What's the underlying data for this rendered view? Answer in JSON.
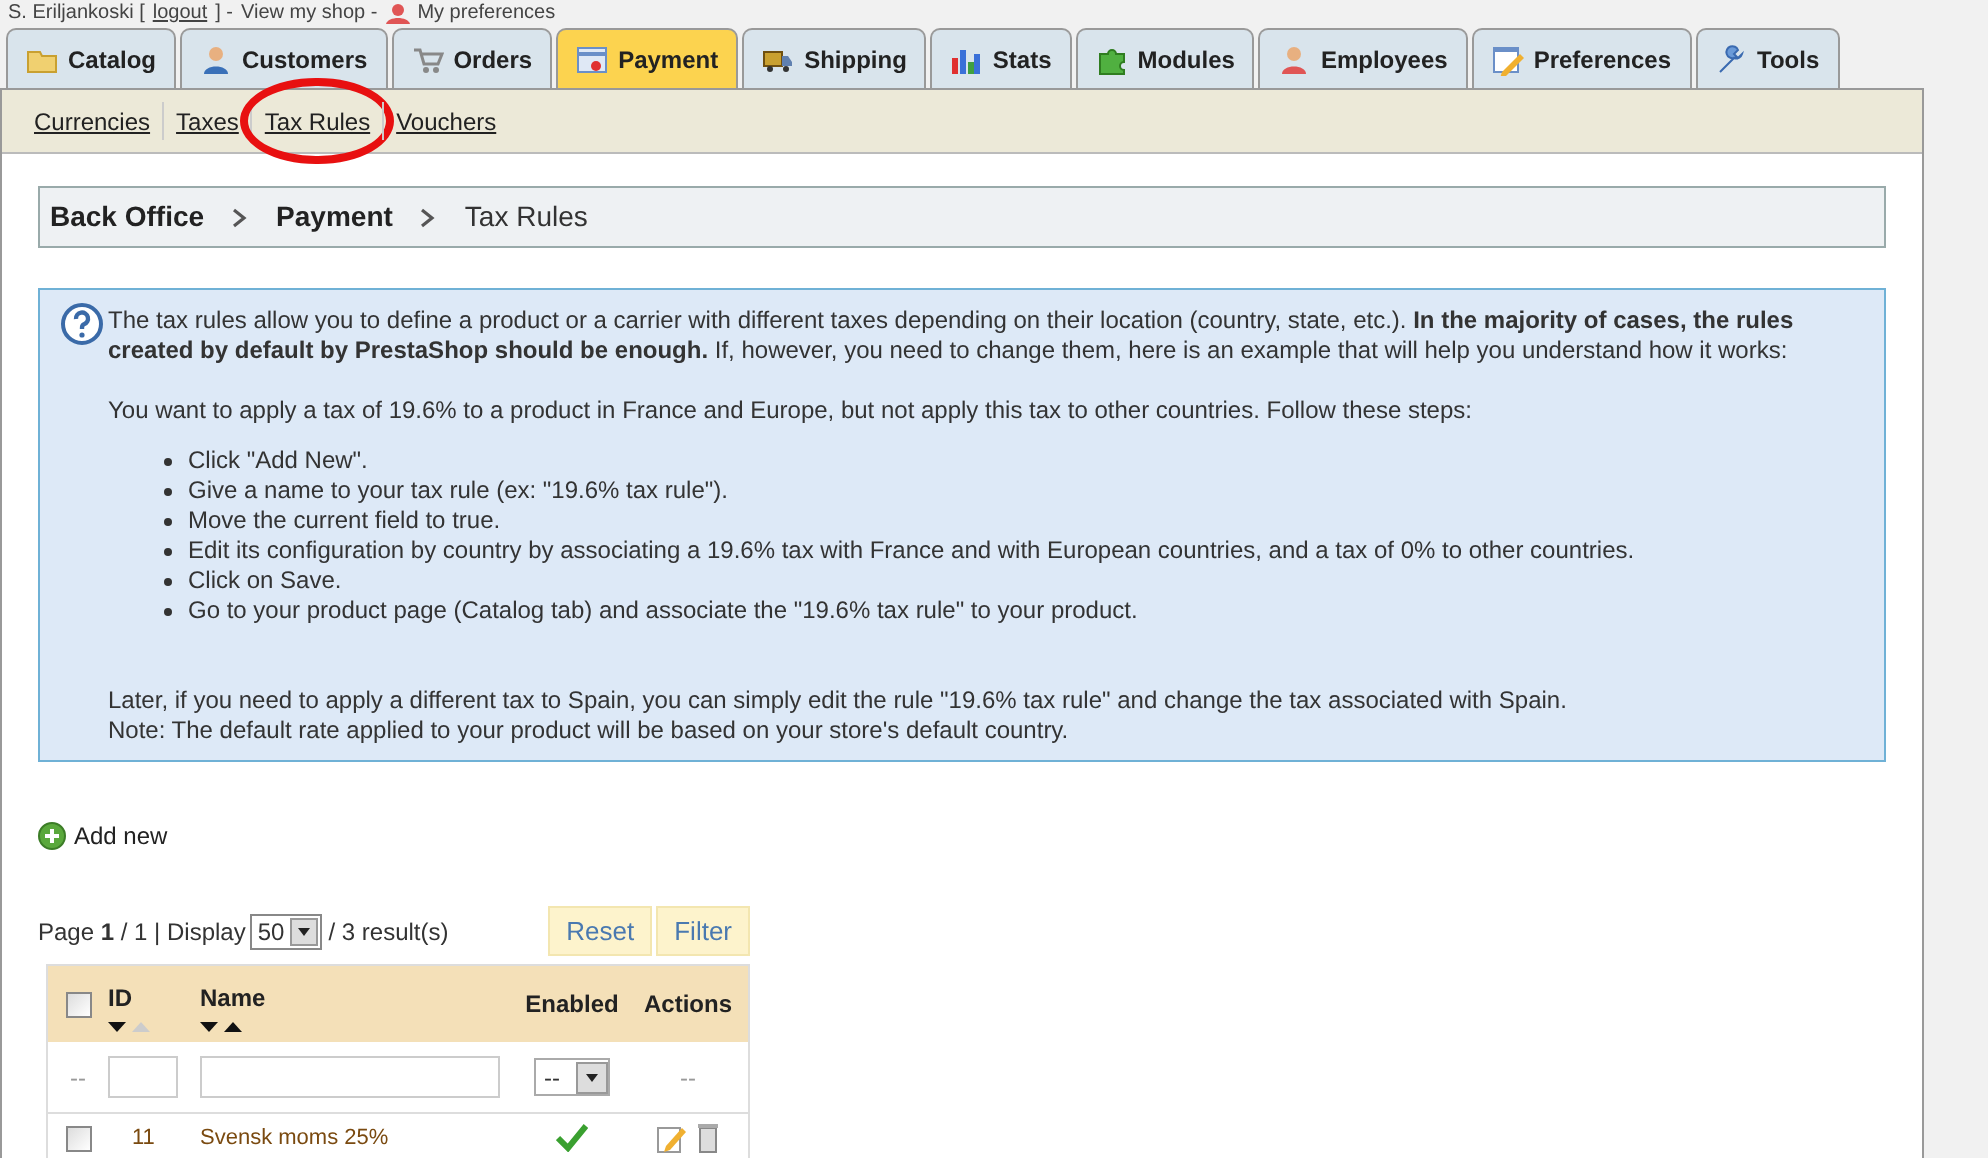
{
  "header": {
    "user": "S. Eriljankoski [",
    "logout": "logout",
    "after_logout": "] -",
    "view_shop": "View my shop -",
    "preferences": "My preferences"
  },
  "tabs": [
    {
      "label": "Catalog",
      "selected": false
    },
    {
      "label": "Customers",
      "selected": false
    },
    {
      "label": "Orders",
      "selected": false
    },
    {
      "label": "Payment",
      "selected": true
    },
    {
      "label": "Shipping",
      "selected": false
    },
    {
      "label": "Stats",
      "selected": false
    },
    {
      "label": "Modules",
      "selected": false
    },
    {
      "label": "Employees",
      "selected": false
    },
    {
      "label": "Preferences",
      "selected": false
    },
    {
      "label": "Tools",
      "selected": false
    }
  ],
  "subtabs": [
    {
      "label": "Currencies",
      "circled": false
    },
    {
      "label": "Taxes",
      "circled": false
    },
    {
      "label": "Tax Rules",
      "circled": true
    },
    {
      "label": "Vouchers",
      "circled": false
    }
  ],
  "breadcrumb": [
    "Back Office",
    "Payment",
    "Tax Rules"
  ],
  "info": {
    "intro": "The tax rules allow you to define a product or a carrier with different taxes depending on their location (country, state, etc.). **In the majority of cases, the rules created by default by PrestaShop should be enough.** If, however, you need to change them, here is an example that will help you understand how it works:",
    "example": "You want to apply a tax of 19.6% to a product in France and Europe, but not apply this tax to other countries. Follow these steps:",
    "steps": [
      "Click \"Add New\".",
      "Give a name to your tax rule (ex: \"19.6% tax rule\").",
      "Move the current field to true.",
      "Edit its configuration by country by associating a 19.6% tax with France and with European countries, and a tax of 0% to other countries.",
      "Click on Save.",
      "Go to your product page (Catalog tab) and associate the \"19.6% tax rule\" to your product."
    ],
    "notes": [
      "Later, if you need to apply a different tax to Spain, you can simply edit the rule \"19.6% tax rule\" and change the tax associated with Spain.",
      "Note: The default rate applied to your product will be based on your store's default country."
    ]
  },
  "add_new": "Add new",
  "pagination": {
    "text": "Page **1** / 1 | Display",
    "per_page": "50",
    "results": "/ 3 result(s)"
  },
  "buttons": [
    "Reset",
    "Filter"
  ],
  "table": {
    "all_checked": false,
    "columns": [
      "ID",
      "Name",
      "Enabled",
      "Actions"
    ],
    "filter": {
      "select_label": "--",
      "dash": "--",
      "actions": "--"
    },
    "rows": [
      {
        "id": "11",
        "name": "Svensk moms 25%",
        "enabled": true,
        "checked": false
      }
    ]
  }
}
